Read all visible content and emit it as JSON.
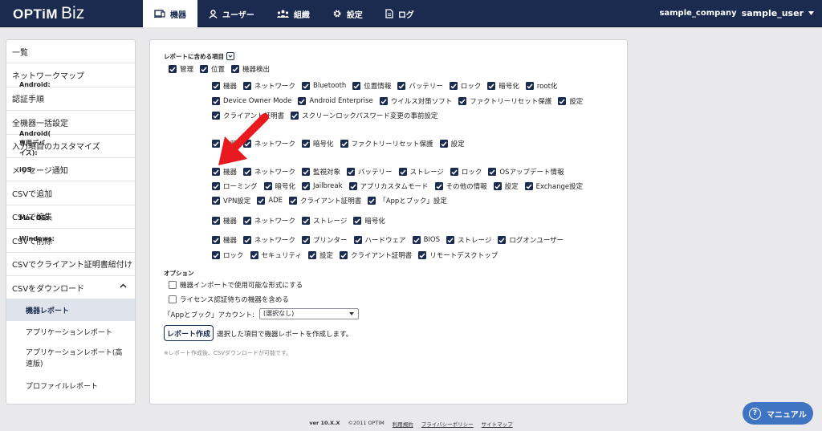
{
  "header": {
    "logo_main": "OPTiM",
    "logo_sub": "Biz",
    "nav": [
      {
        "label": "機器",
        "icon": "device-icon",
        "active": true
      },
      {
        "label": "ユーザー",
        "icon": "user-icon"
      },
      {
        "label": "組織",
        "icon": "organization-icon"
      },
      {
        "label": "設定",
        "icon": "gear-icon"
      },
      {
        "label": "ログ",
        "icon": "log-icon"
      }
    ],
    "company": "sample_company",
    "user": "sample_user"
  },
  "sidebar": {
    "items": [
      "一覧",
      "ネットワークマップ",
      "認証手順",
      "全機器一括設定",
      "入力項目のカスタマイズ",
      "メッセージ通知",
      "CSVで追加",
      "CSVで編集",
      "CSVで削除",
      "CSVでクライアント証明書紐付け",
      "CSVをダウンロード"
    ],
    "sub_items": [
      "機器レポート",
      "アプリケーションレポート",
      "アプリケーションレポート(高速版)",
      "プロファイルレポート"
    ]
  },
  "report": {
    "section_title": "レポートに含める項目",
    "common": [
      "管理",
      "位置",
      "機器検出"
    ],
    "android_label": "Android:",
    "android_row1": [
      "機器",
      "ネットワーク",
      "Bluetooth",
      "位置情報",
      "バッテリー",
      "ロック",
      "暗号化",
      "root化"
    ],
    "android_row2": [
      "Device Owner Mode",
      "Android Enterprise",
      "ウイルス対策ソフト",
      "ファクトリーリセット保護",
      "設定"
    ],
    "android_row3": [
      "クライアント証明書",
      "スクリーンロックパスワード変更の事前設定"
    ],
    "android_dedicated_label1": "Android(",
    "android_dedicated_label2": "専用デバ",
    "android_dedicated_label3": "イス):",
    "android_dedicated": [
      "機器",
      "ネットワーク",
      "暗号化",
      "ファクトリーリセット保護",
      "設定"
    ],
    "ios_label": "iOS:",
    "ios_row1": [
      "機器",
      "ネットワーク",
      "監視対象",
      "バッテリー",
      "ストレージ",
      "ロック",
      "OSアップデート情報"
    ],
    "ios_row2": [
      "ローミング",
      "暗号化",
      "Jailbreak",
      "アプリカスタムモード",
      "その他の情報",
      "設定",
      "Exchange設定"
    ],
    "ios_row3": [
      "VPN設定",
      "ADE",
      "クライアント証明書",
      "「Appとブック」設定"
    ],
    "mac_label": "Mac OS:",
    "mac": [
      "機器",
      "ネットワーク",
      "ストレージ",
      "暗号化"
    ],
    "windows_label": "Windows:",
    "windows_row1": [
      "機器",
      "ネットワーク",
      "プリンター",
      "ハードウェア",
      "BIOS",
      "ストレージ",
      "ログオンユーザー"
    ],
    "windows_row2": [
      "ロック",
      "セキュリティ",
      "設定",
      "クライアント証明書",
      "リモートデスクトップ"
    ]
  },
  "options": {
    "title": "オプション",
    "import_format": "機器インポートで使用可能な形式にする",
    "include_pending": "ライセンス認証待ちの機器を含める",
    "account_label": "「Appとブック」アカウント:",
    "account_value": "(選択なし)",
    "generate_button": "レポート作成",
    "generate_desc": "選択した項目で機器レポートを作成します。",
    "note": "※レポート作成後、CSVダウンロードが可能です。"
  },
  "footer": {
    "version": "ver 10.X.X",
    "copyright": "©2011 OPTiM",
    "terms": "利用規約",
    "privacy": "プライバシーポリシー",
    "sitemap": "サイトマップ"
  },
  "manual_button": "マニュアル",
  "colors": {
    "navy": "#1b2a4f",
    "accent_blue": "#3f74c2",
    "arrow_red": "#e8191f"
  }
}
